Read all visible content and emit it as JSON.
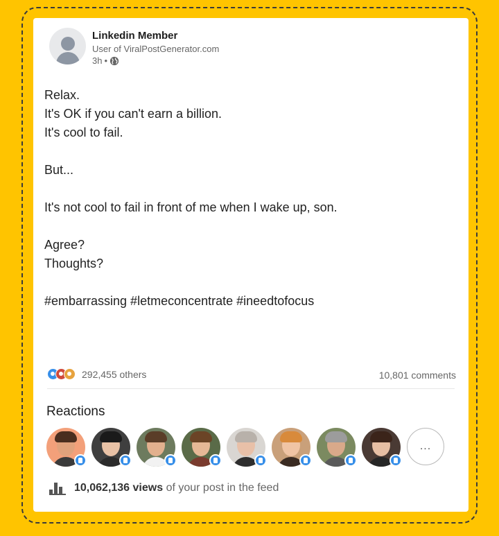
{
  "post": {
    "author": "Linkedin Member",
    "subtitle": "User of ViralPostGenerator.com",
    "time": "3h",
    "separator": "•",
    "body": {
      "p1": "Relax.",
      "p2": "It's OK if you can't earn a billion.",
      "p3": "It's cool to fail.",
      "p4": "But...",
      "p5": "It's not cool to fail in front of me when I wake up, son.",
      "p6": "Agree?",
      "p7": "Thoughts?",
      "p8": "#embarrassing #letmeconcentrate #ineedtofocus"
    }
  },
  "stats": {
    "others": "292,455 others",
    "comments": "10,801 comments"
  },
  "reactions": {
    "title": "Reactions",
    "more_label": "...",
    "people": [
      {
        "bg": "#f3a07a",
        "skin": "#e0a27c",
        "hair": "#4a2e1f",
        "shirt": "#3a3a3a"
      },
      {
        "bg": "#3f3f3f",
        "skin": "#e9c2a6",
        "hair": "#1a1a1a",
        "shirt": "#2b2b2b"
      },
      {
        "bg": "#6d7b5e",
        "skin": "#e2b08e",
        "hair": "#5a3d28",
        "shirt": "#f2f2f2"
      },
      {
        "bg": "#5a6b48",
        "skin": "#e6b896",
        "hair": "#6b4426",
        "shirt": "#7a3b2e"
      },
      {
        "bg": "#d9d6d2",
        "skin": "#e8c0a8",
        "hair": "#b8b1aa",
        "shirt": "#2e2e2e"
      },
      {
        "bg": "#c9a07a",
        "skin": "#f0c4a4",
        "hair": "#d88a3b",
        "shirt": "#3a2b22"
      },
      {
        "bg": "#7b8a60",
        "skin": "#d9a98a",
        "hair": "#9c9c9c",
        "shirt": "#5a5a5a"
      },
      {
        "bg": "#4a3a34",
        "skin": "#e7bfa4",
        "hair": "#3b241a",
        "shirt": "#262626"
      }
    ]
  },
  "views": {
    "count": "10,062,136 views",
    "suffix": "of your post in the feed"
  },
  "colors": {
    "background": "#FFC400",
    "like_blue": "#378fe9"
  }
}
